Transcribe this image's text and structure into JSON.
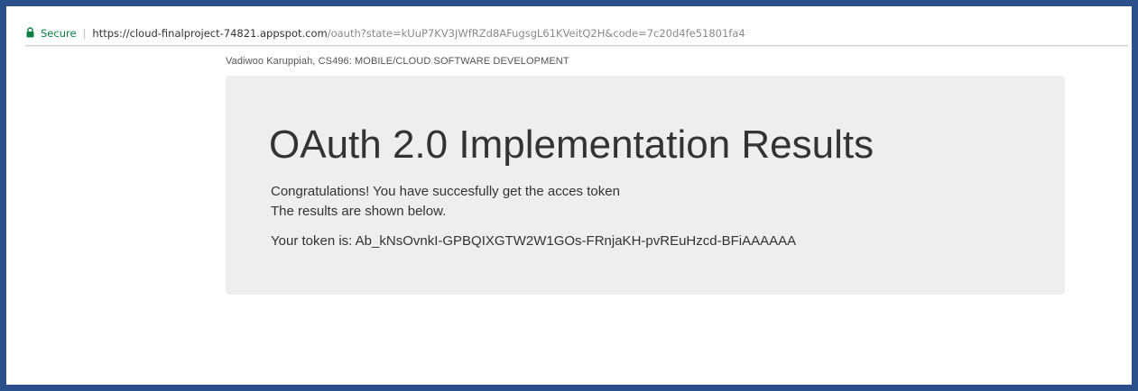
{
  "browser": {
    "secure_label": "Secure",
    "separator": "|",
    "url_host": "https://cloud-finalproject-74821.appspot.com",
    "url_rest": "/oauth?state=kUuP7KV3JWfRZd8AFugsgL61KVeitQ2H&code=7c20d4fe51801fa4",
    "lock_color": "#0b8043"
  },
  "page": {
    "author_line": "Vadiwoo Karuppiah, CS496: MOBILE/CLOUD SOFTWARE DEVELOPMENT",
    "title": "OAuth 2.0 Implementation Results",
    "message_line1": "Congratulations! You have succesfully get the acces token",
    "message_line2": "The results are shown below.",
    "token_line": "Your token is: Ab_kNsOvnkI-GPBQIXGTW2W1GOs-FRnjaKH-pvREuHzcd-BFiAAAAAA"
  },
  "colors": {
    "frame_border": "#2b4f8a",
    "jumbotron_bg": "#eeeeee",
    "text": "#333333"
  }
}
